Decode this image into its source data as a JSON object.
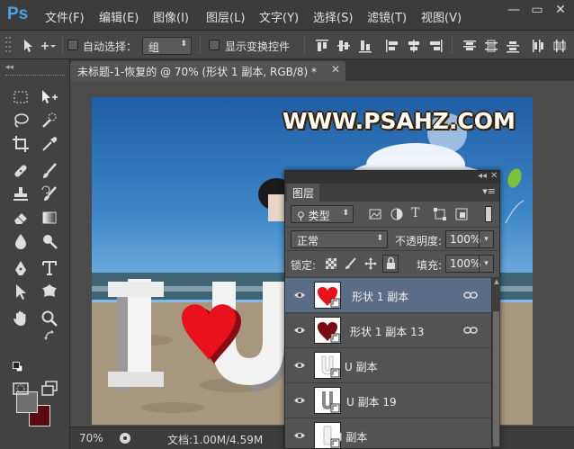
{
  "app": {
    "logo": "Ps",
    "accent": "#4ea3e8"
  },
  "menu": {
    "items": [
      "文件(F)",
      "编辑(E)",
      "图像(I)",
      "图层(L)",
      "文字(Y)",
      "选择(S)",
      "滤镜(T)",
      "视图(V)"
    ]
  },
  "window_controls": {
    "minimize": "—",
    "restore": "▭",
    "close": "✕"
  },
  "options_bar": {
    "auto_select_label": "自动选择：",
    "auto_select_value": "组",
    "show_transform_label": "显示变换控件"
  },
  "document": {
    "tab_title": "未标题-1-恢复的 @ 70% (形状 1 副本, RGB/8) *",
    "watermark": "WWW.PSAHZ.COM"
  },
  "status": {
    "zoom": "70%",
    "doc_size": "文档:1.00M/4.59M"
  },
  "colors": {
    "foreground": "#707070",
    "background": "#5a0a10",
    "heart": "#e8111c",
    "selection": "#5b6c86"
  },
  "layers_panel": {
    "tab_label": "图层",
    "filter_label": "类型",
    "blend_mode": "正常",
    "opacity_label": "不透明度:",
    "opacity_value": "100%",
    "lock_label": "锁定:",
    "fill_label": "填充:",
    "fill_value": "100%",
    "layers": [
      {
        "name": "形状 1 副本",
        "thumb": "heart-red",
        "selected": true,
        "linked": true
      },
      {
        "name": "形状 1 副本 13",
        "thumb": "heart-dark",
        "selected": false,
        "linked": true
      },
      {
        "name": "U 副本",
        "thumb": "white-u",
        "selected": false,
        "linked": false
      },
      {
        "name": "U 副本 19",
        "thumb": "gray-u",
        "selected": false,
        "linked": false
      },
      {
        "name": "I 副本",
        "thumb": "white-i",
        "selected": false,
        "linked": false
      }
    ]
  }
}
